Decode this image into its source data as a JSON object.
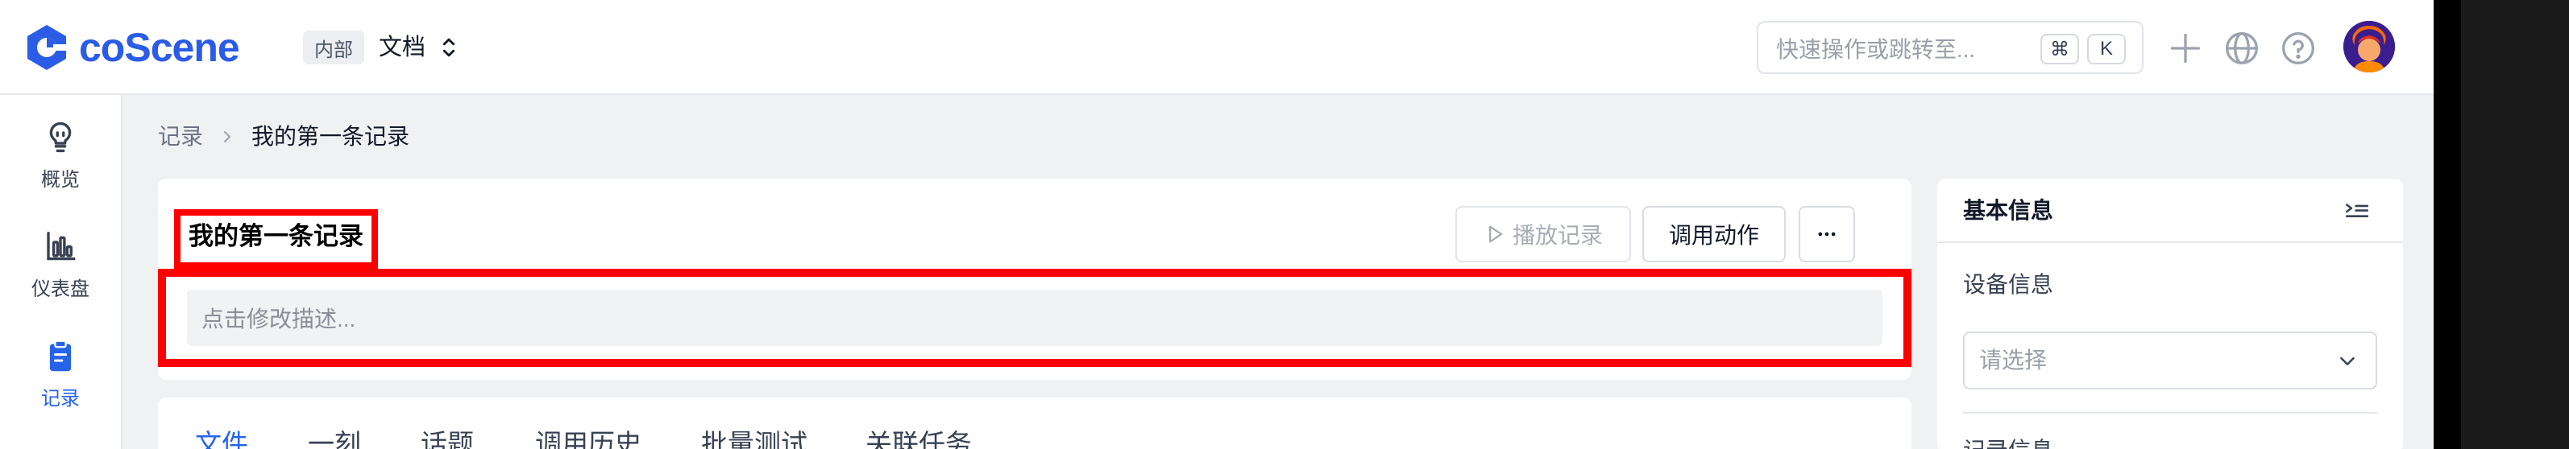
{
  "header": {
    "brand": "coScene",
    "space_badge": "内部",
    "space_name": "文档",
    "search_placeholder": "快速操作或跳转至...",
    "shortcut_keys": [
      "⌘",
      "K"
    ],
    "icons": [
      "plus-icon",
      "globe-icon",
      "help-icon"
    ]
  },
  "sidebar": {
    "items": [
      {
        "label": "概览",
        "icon": "lightbulb-icon"
      },
      {
        "label": "仪表盘",
        "icon": "bar-chart-icon"
      },
      {
        "label": "记录",
        "icon": "clipboard-icon",
        "active": true
      }
    ]
  },
  "breadcrumb": {
    "parent": "记录",
    "current": "我的第一条记录"
  },
  "record": {
    "title": "我的第一条记录",
    "description_placeholder": "点击修改描述...",
    "actions": {
      "play": "播放记录",
      "invoke": "调用动作",
      "more": "···"
    }
  },
  "tabs": [
    "文件",
    "一刻",
    "话题",
    "调用历史",
    "批量测试",
    "关联任务"
  ],
  "panel": {
    "title": "基本信息",
    "device_label": "设备信息",
    "select_placeholder": "请选择",
    "next_section": "记录信息"
  },
  "colors": {
    "brand": "#2b5ce6",
    "active": "#2563eb",
    "highlight": "#ff0000"
  }
}
